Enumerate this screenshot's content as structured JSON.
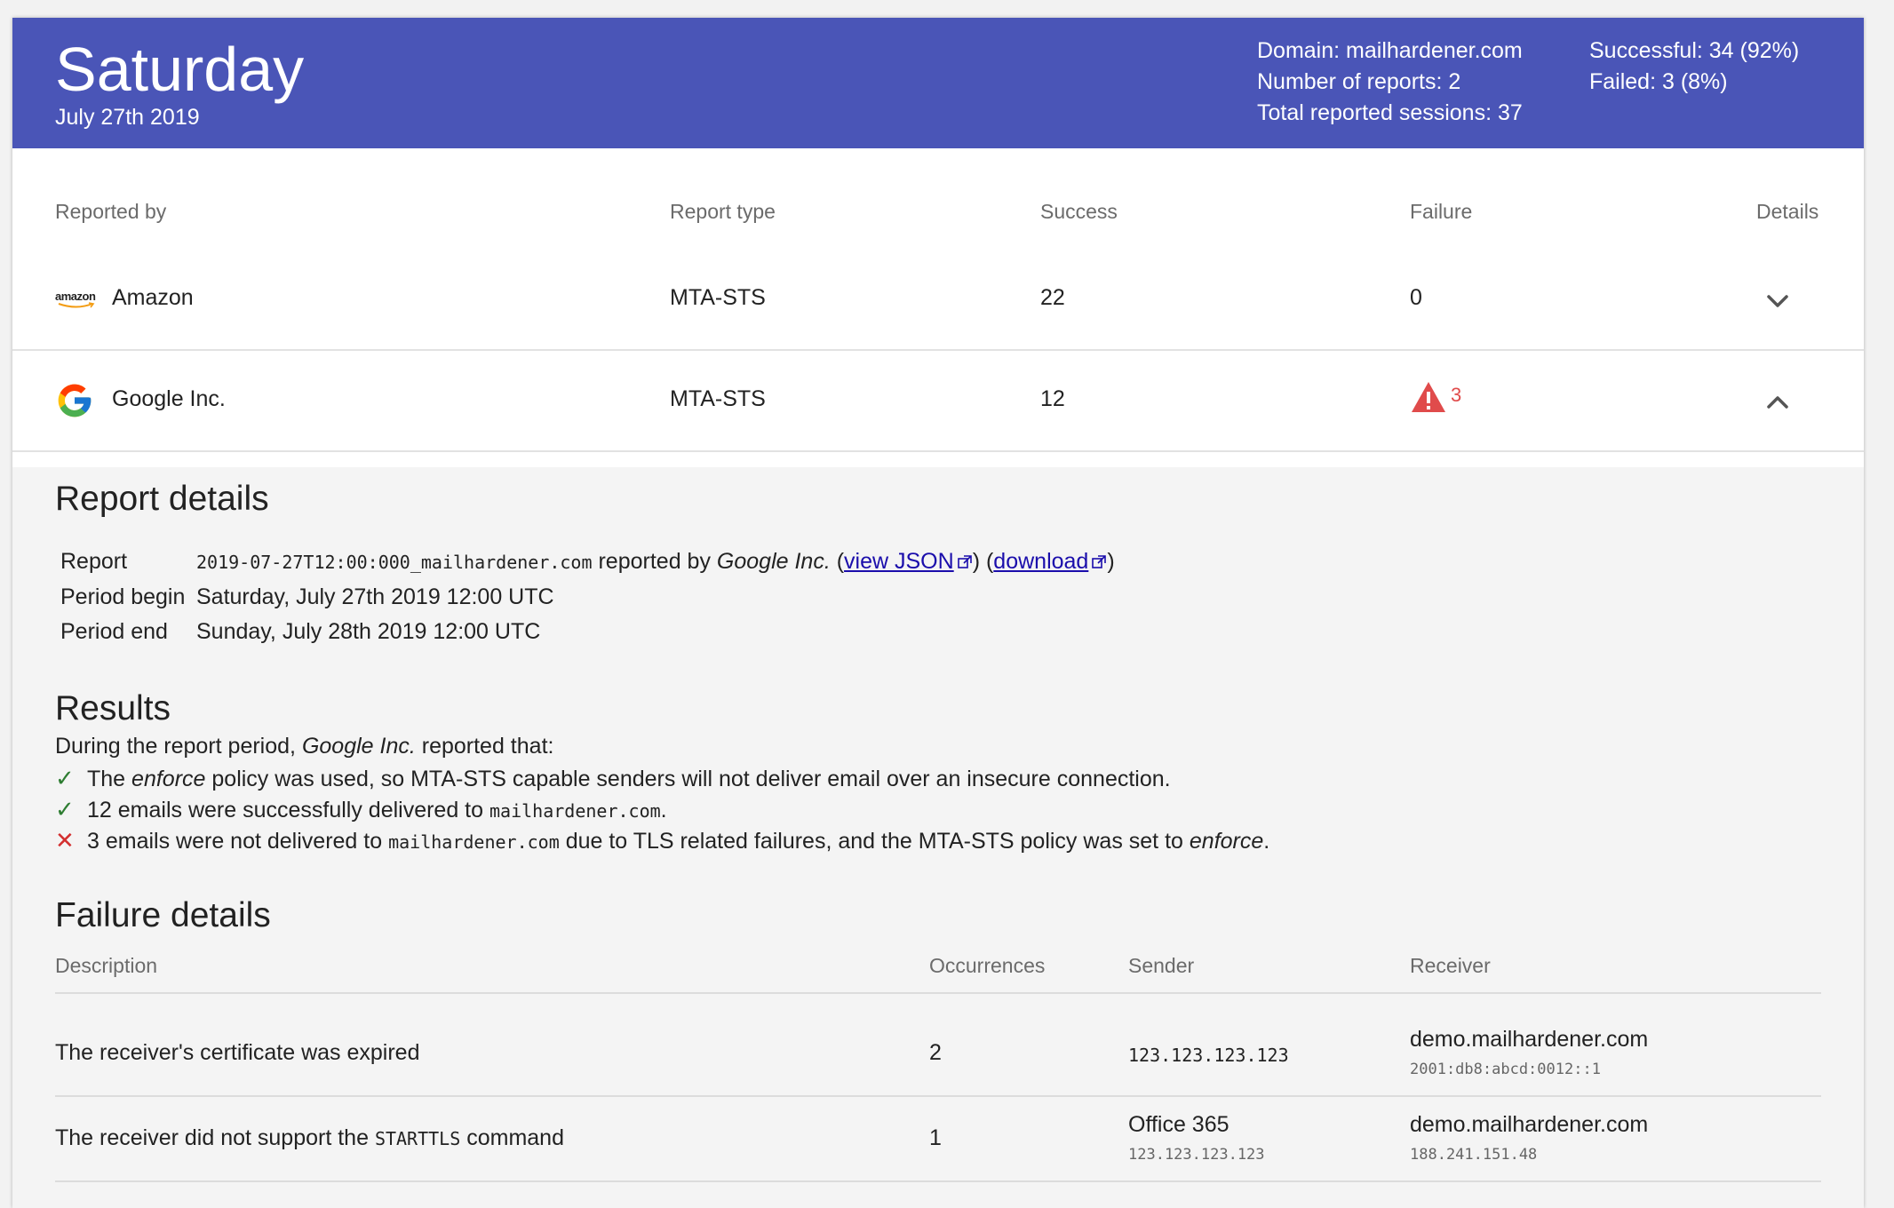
{
  "header": {
    "day": "Saturday",
    "date": "July 27th 2019",
    "domain": "Domain: mailhardener.com",
    "num_reports": "Number of reports: 2",
    "total_sessions": "Total reported sessions: 37",
    "successful": "Successful: 34 (92%)",
    "failed": "Failed: 3 (8%)",
    "background_color": "#4a55b7"
  },
  "table": {
    "columns": [
      "Reported by",
      "Report type",
      "Success",
      "Failure",
      "Details"
    ],
    "rows": [
      {
        "reporter": "Amazon",
        "logo": "amazon-logo",
        "logo_text": "amazon",
        "type": "MTA-STS",
        "success": "22",
        "failure": "0",
        "toggle": "chevron-down-icon"
      },
      {
        "reporter": "Google Inc.",
        "logo": "google-logo",
        "type": "MTA-STS",
        "success": "12",
        "failure": "3",
        "toggle": "chevron-up-icon"
      }
    ]
  },
  "details": {
    "title": "Report details",
    "report_label": "Report",
    "report_id": "2019-07-27T12:00:000_mailhardener.com",
    "reported_by_text": "reported by",
    "reporter": "Google Inc.",
    "view_json": "view JSON",
    "download": "download",
    "period_begin_label": "Period begin",
    "period_begin": "Saturday, July 27th 2019 12:00 UTC",
    "period_end_label": "Period end",
    "period_end": "Sunday, July 28th 2019 12:00 UTC"
  },
  "results": {
    "title": "Results",
    "intro_prefix": "During the report period,",
    "intro_reporter": "Google Inc.",
    "intro_suffix": "reported that:",
    "line1_a": "The",
    "line1_em": "enforce",
    "line1_b": "policy was used, so MTA-STS capable senders will not deliver email over an insecure connection.",
    "line2_a": "12 emails were successfully delivered to",
    "line2_domain": "mailhardener.com",
    "line2_b": ".",
    "line3_a": "3 emails were not delivered to",
    "line3_domain": "mailhardener.com",
    "line3_b": "due to TLS related failures, and the MTA-STS policy was set to",
    "line3_em": "enforce",
    "line3_c": "."
  },
  "failures": {
    "title": "Failure details",
    "columns": [
      "Description",
      "Occurrences",
      "Sender",
      "Receiver"
    ],
    "rows": [
      {
        "description": "The receiver's certificate was expired",
        "occurrences": "2",
        "sender": "123.123.123.123",
        "sender_sub": "",
        "receiver": "demo.mailhardener.com",
        "receiver_sub": "2001:db8:abcd:0012::1"
      },
      {
        "description_a": "The receiver did not support the",
        "description_code": "STARTTLS",
        "description_b": "command",
        "occurrences": "1",
        "sender": "Office 365",
        "sender_sub": "123.123.123.123",
        "receiver": "demo.mailhardener.com",
        "receiver_sub": "188.241.151.48"
      }
    ]
  }
}
